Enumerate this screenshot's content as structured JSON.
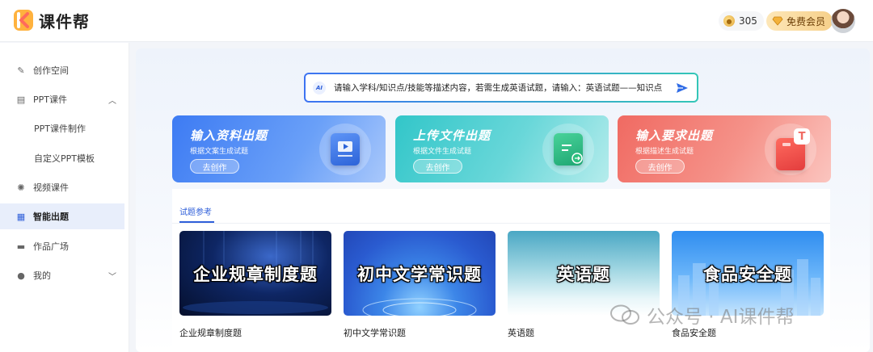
{
  "app": {
    "name": "课件帮"
  },
  "header": {
    "coins": "305",
    "vip_label": "免费会员",
    "coin_icon": "coin-icon",
    "vip_icon": "diamond-icon"
  },
  "sidebar": {
    "items": [
      {
        "label": "创作空间",
        "icon": "pen-icon"
      },
      {
        "label": "PPT课件",
        "icon": "presentation-icon",
        "expanded": true
      },
      {
        "label": "PPT课件制作"
      },
      {
        "label": "自定义PPT模板"
      },
      {
        "label": "视频课件",
        "icon": "bulb-icon"
      },
      {
        "label": "智能出题",
        "icon": "grid-icon",
        "active": true
      },
      {
        "label": "作品广场",
        "icon": "folder-icon"
      },
      {
        "label": "我的",
        "icon": "user-icon"
      }
    ]
  },
  "search": {
    "badge": "AI",
    "text": "请输入学科/知识点/技能等描述内容，若需生成英语试题，请输入：英语试题——知识点"
  },
  "cards": [
    {
      "title": "输入资料出题",
      "subtitle": "根据文案生成试题",
      "button": "去创作"
    },
    {
      "title": "上传文件出题",
      "subtitle": "根据文件生成试题",
      "button": "去创作"
    },
    {
      "title": "输入要求出题",
      "subtitle": "根据描述生成试题",
      "button": "去创作"
    }
  ],
  "section": {
    "tab": "试题参考",
    "items": [
      {
        "thumb": "企业规章制度题",
        "caption": "企业规章制度题"
      },
      {
        "thumb": "初中文学常识题",
        "caption": "初中文学常识题"
      },
      {
        "thumb": "英语题",
        "caption": "英语题"
      },
      {
        "thumb": "食品安全题",
        "caption": "食品安全题"
      }
    ]
  },
  "watermark": "公众号 · AI课件帮",
  "colors": {
    "accent": "#2f5fd9",
    "active_bg": "#e8eefb"
  }
}
